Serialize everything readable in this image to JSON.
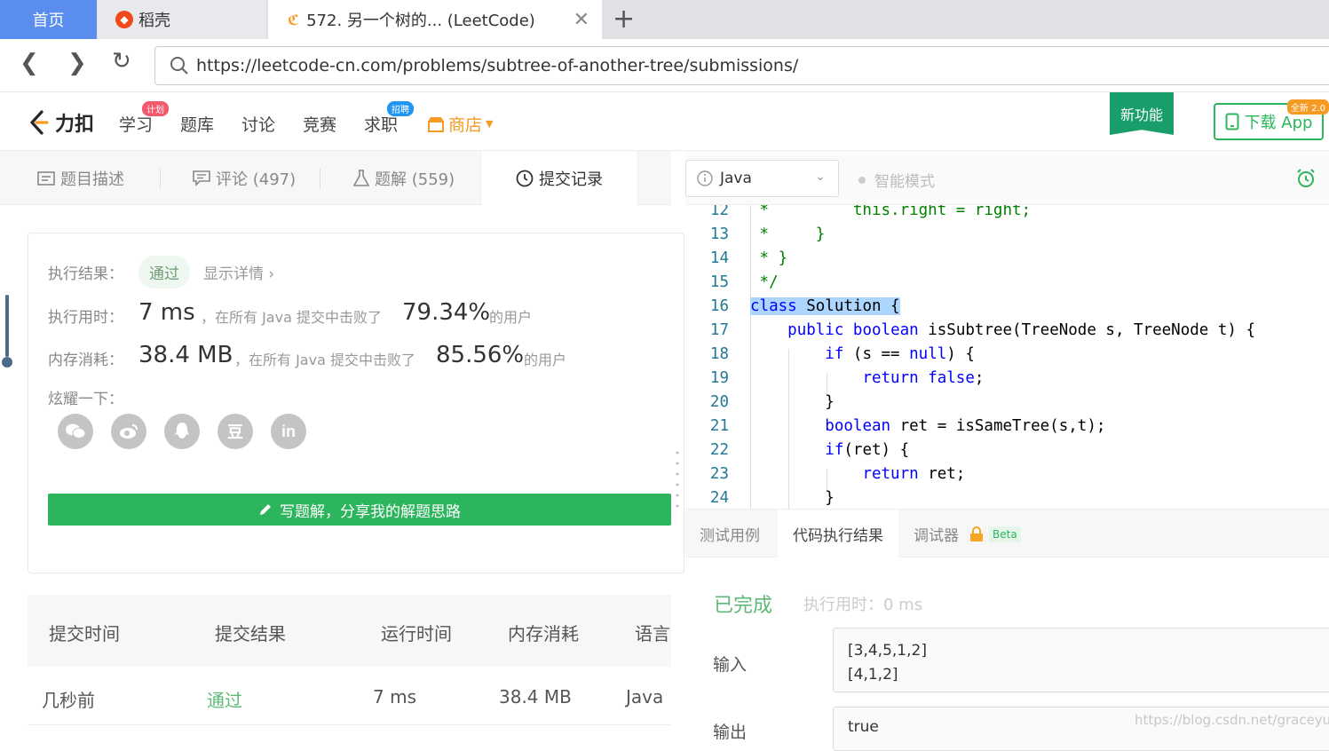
{
  "browser": {
    "tabs": [
      {
        "label": "首页"
      },
      {
        "label": "稻壳"
      },
      {
        "label": "572. 另一个树的...  (LeetCode)"
      }
    ],
    "url": "https://leetcode-cn.com/problems/subtree-of-another-tree/submissions/"
  },
  "site": {
    "logo_text": "力扣",
    "nav": [
      {
        "label": "学习",
        "badge": "计划"
      },
      {
        "label": "题库"
      },
      {
        "label": "讨论"
      },
      {
        "label": "竞赛"
      },
      {
        "label": "求职",
        "badge": "招聘"
      },
      {
        "label": "商店"
      }
    ],
    "new_feature": "新功能",
    "download_app": "下载 App",
    "download_badge": "全新 2.0"
  },
  "left_tabs": [
    {
      "label": "题目描述"
    },
    {
      "label": "评论 (497)"
    },
    {
      "label": "题解 (559)"
    },
    {
      "label": "提交记录"
    }
  ],
  "result": {
    "exec_label": "执行结果：",
    "status": "通过",
    "details": "显示详情 ›",
    "time_label": "执行用时：",
    "time_value": "7 ms",
    "time_text": "，在所有 Java 提交中击败了",
    "time_pct": "79.34%",
    "users_suffix": "的用户",
    "mem_label": "内存消耗：",
    "mem_value": "38.4 MB",
    "mem_text": "，在所有 Java 提交中击败了",
    "mem_pct": "85.56%",
    "share_label": "炫耀一下：",
    "share_icons": [
      "wechat-icon",
      "weibo-icon",
      "qq-icon",
      "douban-icon",
      "linkedin-icon"
    ],
    "write_button": "写题解，分享我的解题思路"
  },
  "submissions": {
    "headers": [
      "提交时间",
      "提交结果",
      "运行时间",
      "内存消耗",
      "语言"
    ],
    "rows": [
      [
        "几秒前",
        "通过",
        "7 ms",
        "38.4 MB",
        "Java"
      ]
    ]
  },
  "editor": {
    "language": "Java",
    "smart_mode": "智能模式",
    "lines": [
      {
        "n": "12",
        "text": " *         this.right = right;"
      },
      {
        "n": "13",
        "text": " *     }"
      },
      {
        "n": "14",
        "text": " * }"
      },
      {
        "n": "15",
        "text": " */"
      },
      {
        "n": "16",
        "text": "class Solution {"
      },
      {
        "n": "17",
        "text": "    public boolean isSubtree(TreeNode s, TreeNode t) {"
      },
      {
        "n": "18",
        "text": "        if (s == null) {"
      },
      {
        "n": "19",
        "text": "            return false;"
      },
      {
        "n": "20",
        "text": "        }"
      },
      {
        "n": "21",
        "text": "        boolean ret = isSameTree(s,t);"
      },
      {
        "n": "22",
        "text": "        if(ret) {"
      },
      {
        "n": "23",
        "text": "            return ret;"
      },
      {
        "n": "24",
        "text": "        }"
      }
    ]
  },
  "console": {
    "tabs": [
      "测试用例",
      "代码执行结果",
      "调试器"
    ],
    "beta": "Beta",
    "status": "已完成",
    "exec_time": "执行用时：0 ms",
    "input_label": "输入",
    "input_lines": [
      "[3,4,5,1,2]",
      "[4,1,2]"
    ],
    "output_label": "输出",
    "output_value": "true"
  },
  "watermark": "https://blog.csdn.net/graceyun",
  "colors": {
    "accent_green": "#2db55d",
    "brand_orange": "#f59a23",
    "home_tab_blue": "#5b8def"
  }
}
